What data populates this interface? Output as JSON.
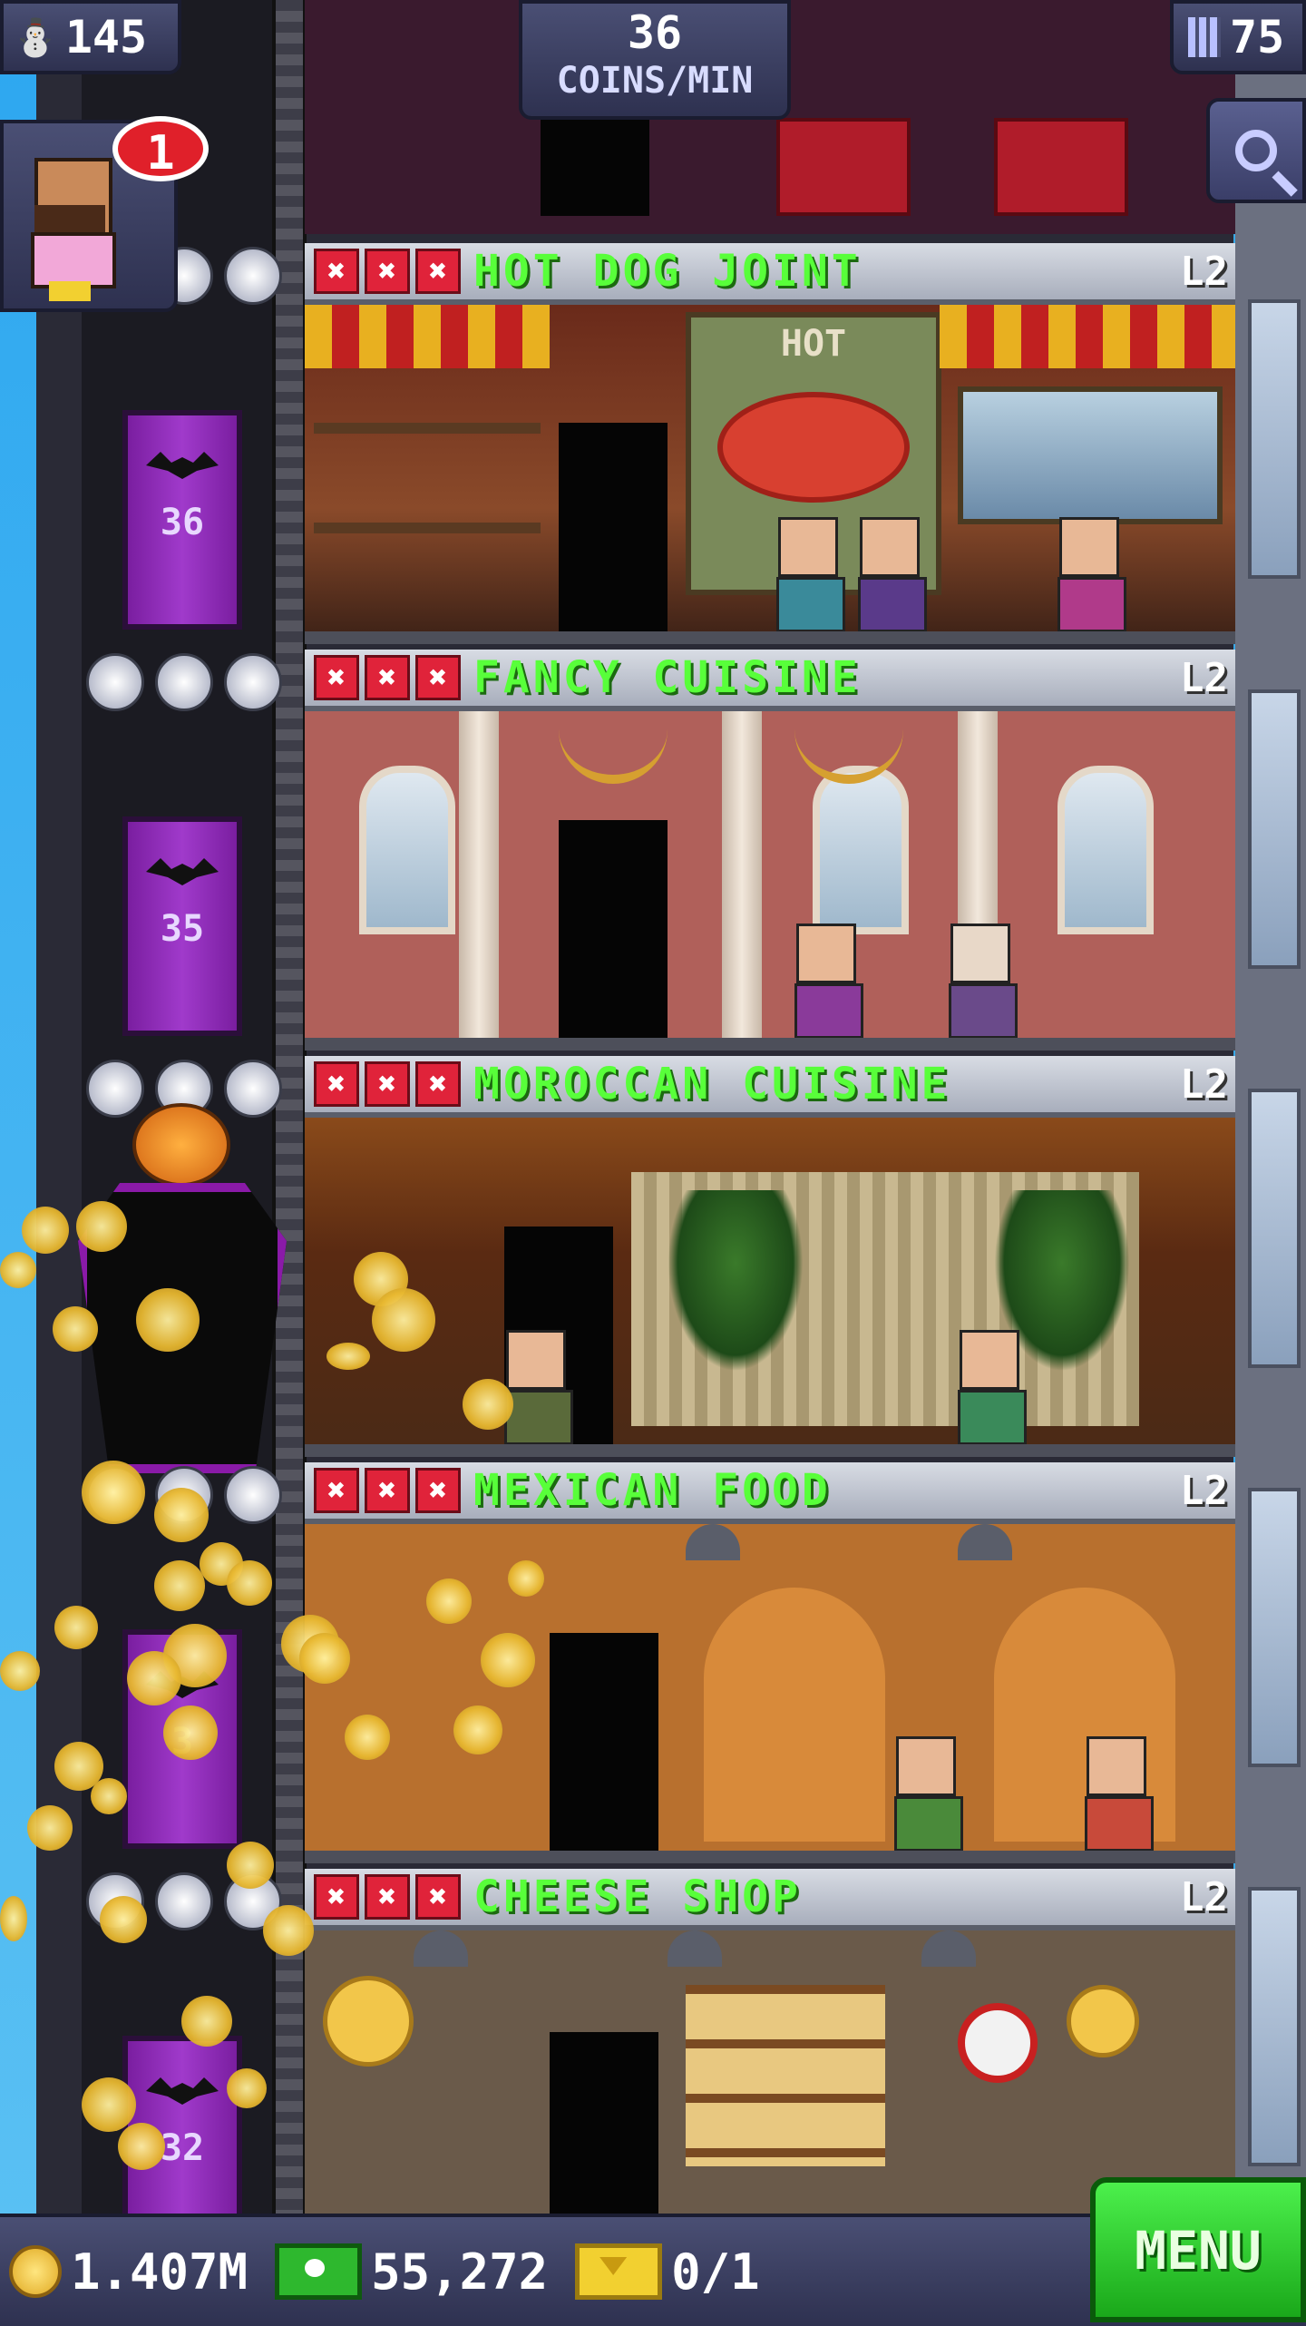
{
  "hud": {
    "population": "145",
    "floors_count": "75",
    "coins_per_min_value": "36",
    "coins_per_min_label": "COINS/MIN"
  },
  "visitor": {
    "badge_count": "1"
  },
  "floors": [
    {
      "name": "HOT DOG JOINT",
      "level": "L2",
      "elevator_floor": "36",
      "x_marks": [
        "✖",
        "✖",
        "✖"
      ]
    },
    {
      "name": "FANCY CUISINE",
      "level": "L2",
      "elevator_floor": "35",
      "x_marks": [
        "✖",
        "✖",
        "✖"
      ]
    },
    {
      "name": "MOROCCAN CUISINE",
      "level": "L2",
      "elevator_floor": "",
      "x_marks": [
        "✖",
        "✖",
        "✖"
      ]
    },
    {
      "name": "MEXICAN FOOD",
      "level": "L2",
      "elevator_floor": "3",
      "x_marks": [
        "✖",
        "✖",
        "✖"
      ]
    },
    {
      "name": "CHEESE SHOP",
      "level": "L2",
      "elevator_floor": "32",
      "x_marks": [
        "✖",
        "✖",
        "✖"
      ]
    }
  ],
  "hotdog_sign": "HOT",
  "bottom_bar": {
    "coins": "1.407M",
    "bux": "55,272",
    "tickets": "0/1",
    "menu_label": "MENU"
  },
  "colors": {
    "floor_name": "#58ff3a",
    "xmark": "#e0233a",
    "elevator": "#a03acb",
    "menu": "#2ecc2e"
  }
}
